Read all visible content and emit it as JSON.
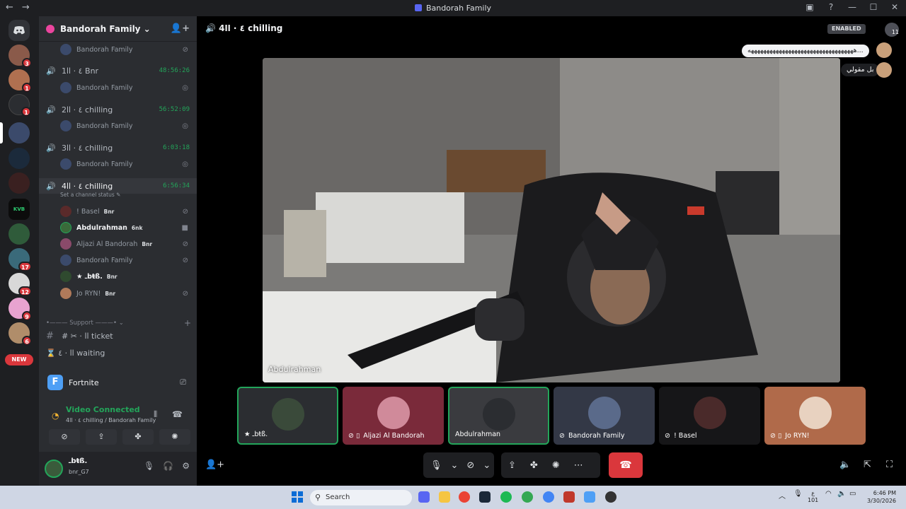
{
  "window": {
    "title": "Bandorah Family",
    "nav_back": "←",
    "nav_fwd": "→",
    "icons": [
      "inbox-icon",
      "help-icon",
      "minimize-icon",
      "maximize-icon",
      "close-icon"
    ]
  },
  "servers": {
    "badges": [
      "3",
      "1",
      "1",
      "17",
      "12",
      "9",
      "6"
    ],
    "new_label": "NEW"
  },
  "guild": {
    "name": "Bandorah Family ⌄"
  },
  "channels": [
    {
      "name": "Bandorah Family",
      "type": "member_top"
    },
    {
      "name": "1٤ · اا Bnr",
      "timer": "48:56:26",
      "member": "Bandorah Family"
    },
    {
      "name": "2٤ · اا chilling",
      "timer": "56:52:09",
      "member": "Bandorah Family"
    },
    {
      "name": "3٤ · اا chilling",
      "timer": "6:03:18",
      "member": "Bandorah Family"
    },
    {
      "name": "4٤ · اا chilling",
      "timer": "6:56:34"
    }
  ],
  "status_line": "Set a channel status ✎",
  "active_members": [
    {
      "name": "! Basel",
      "tag": "Bnr"
    },
    {
      "name": "Abdulrahman",
      "tag": "6nk"
    },
    {
      "name": "Aljazi Al Bandorah",
      "tag": "Bnr"
    },
    {
      "name": "Bandorah Family",
      "tag": ""
    },
    {
      "name": "★ ـbŧß.",
      "tag": "Bnr"
    },
    {
      "name": "Jo RYN!",
      "tag": "Bnr"
    }
  ],
  "category": {
    "label": "•——— Support ———• ⌄"
  },
  "text_channels": [
    {
      "name": "اا ticket",
      "prefix": "#  ✂︎ ·"
    },
    {
      "name": "اا waiting",
      "prefix": "⌛ ٤ ·"
    }
  ],
  "activity": {
    "game": "Fortnite"
  },
  "voice": {
    "status": "Video Connected",
    "sub": "4٤ · اا chilling / Bandorah Family"
  },
  "user": {
    "name": "ـbŧß.",
    "status": "bnr_G7"
  },
  "stage": {
    "channel": "4٤ · اا chilling",
    "enabled_label": "ENABLED",
    "notif_count": "11",
    "chat": [
      {
        "text": "ههههههههههههههههههههههههههههههههههه..."
      },
      {
        "text": "بل مقولي"
      }
    ],
    "main_label": "Abdulrahman",
    "tiles": [
      {
        "label": "★  ـbŧß."
      },
      {
        "label": "Aljazi Al Bandorah"
      },
      {
        "label": "Abdulrahman"
      },
      {
        "label": "Bandorah Family"
      },
      {
        "label": "! Basel"
      },
      {
        "label": "Jo RYN!"
      }
    ]
  },
  "taskbar": {
    "search_placeholder": "Search",
    "tray_lang": "ع",
    "tray_lang2": "101",
    "time": "6:46 PM",
    "date": "3/30/2026"
  }
}
